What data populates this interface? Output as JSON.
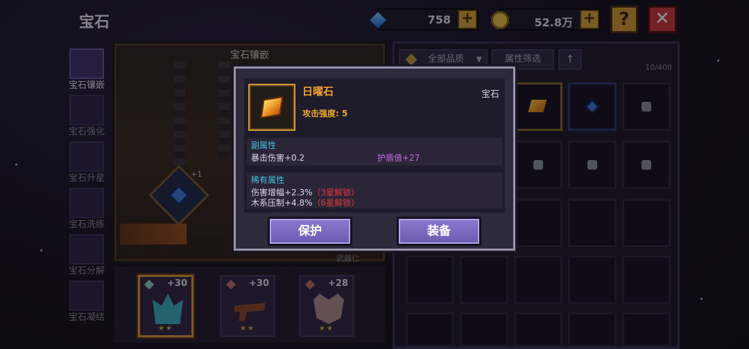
{
  "header": {
    "title": "宝石",
    "diamonds": "758",
    "coins": "52.8万",
    "plus_symbol": "+",
    "help_symbol": "?",
    "close_symbol": "✕"
  },
  "sidebar": {
    "items": [
      {
        "label": "宝石镶嵌",
        "icon": "gem-inlay-icon",
        "active": true
      },
      {
        "label": "宝石强化",
        "icon": "gem-enhance-icon"
      },
      {
        "label": "宝石升星",
        "icon": "star-upgrade-icon"
      },
      {
        "label": "宝石洗练",
        "icon": "gem-refine-icon"
      },
      {
        "label": "宝石分解",
        "icon": "gem-decompose-icon"
      },
      {
        "label": "宝石凝结",
        "icon": "gem-condense-icon"
      }
    ]
  },
  "inlay": {
    "title": "宝石镶嵌",
    "socket_level": "+1",
    "weapon_label": "武器仁"
  },
  "weapons": [
    {
      "level": "+30",
      "stars": "★★",
      "selected": true
    },
    {
      "level": "+30",
      "stars": "★★"
    },
    {
      "level": "+28",
      "stars": "★★"
    }
  ],
  "inventory": {
    "quality_filter": "全部品质",
    "attr_filter": "属性筛选",
    "sort_symbol": "↑",
    "dropdown_symbol": "▼",
    "count": "10/400"
  },
  "popup": {
    "item_name": "日曜石",
    "item_type": "宝石",
    "main_stat": "攻击强度: 5",
    "sub_title": "副属性",
    "sub_stats": [
      "暴击伤害+0.2",
      "护盾值+27"
    ],
    "rare_title": "稀有属性",
    "rare_stats": [
      {
        "text": "伤害增幅+2.3%",
        "lock": "（3星解锁）"
      },
      {
        "text": "木系压制+4.8%",
        "lock": "（6星解锁）"
      }
    ],
    "protect_label": "保护",
    "equip_label": "装备"
  },
  "colors": {
    "accent_gold": "#f2a030",
    "subattr_cyan": "#49c0e0",
    "purple_stat": "#c86ae8",
    "lock_red": "#e0383a",
    "button_purple": "#7a6ac0"
  }
}
